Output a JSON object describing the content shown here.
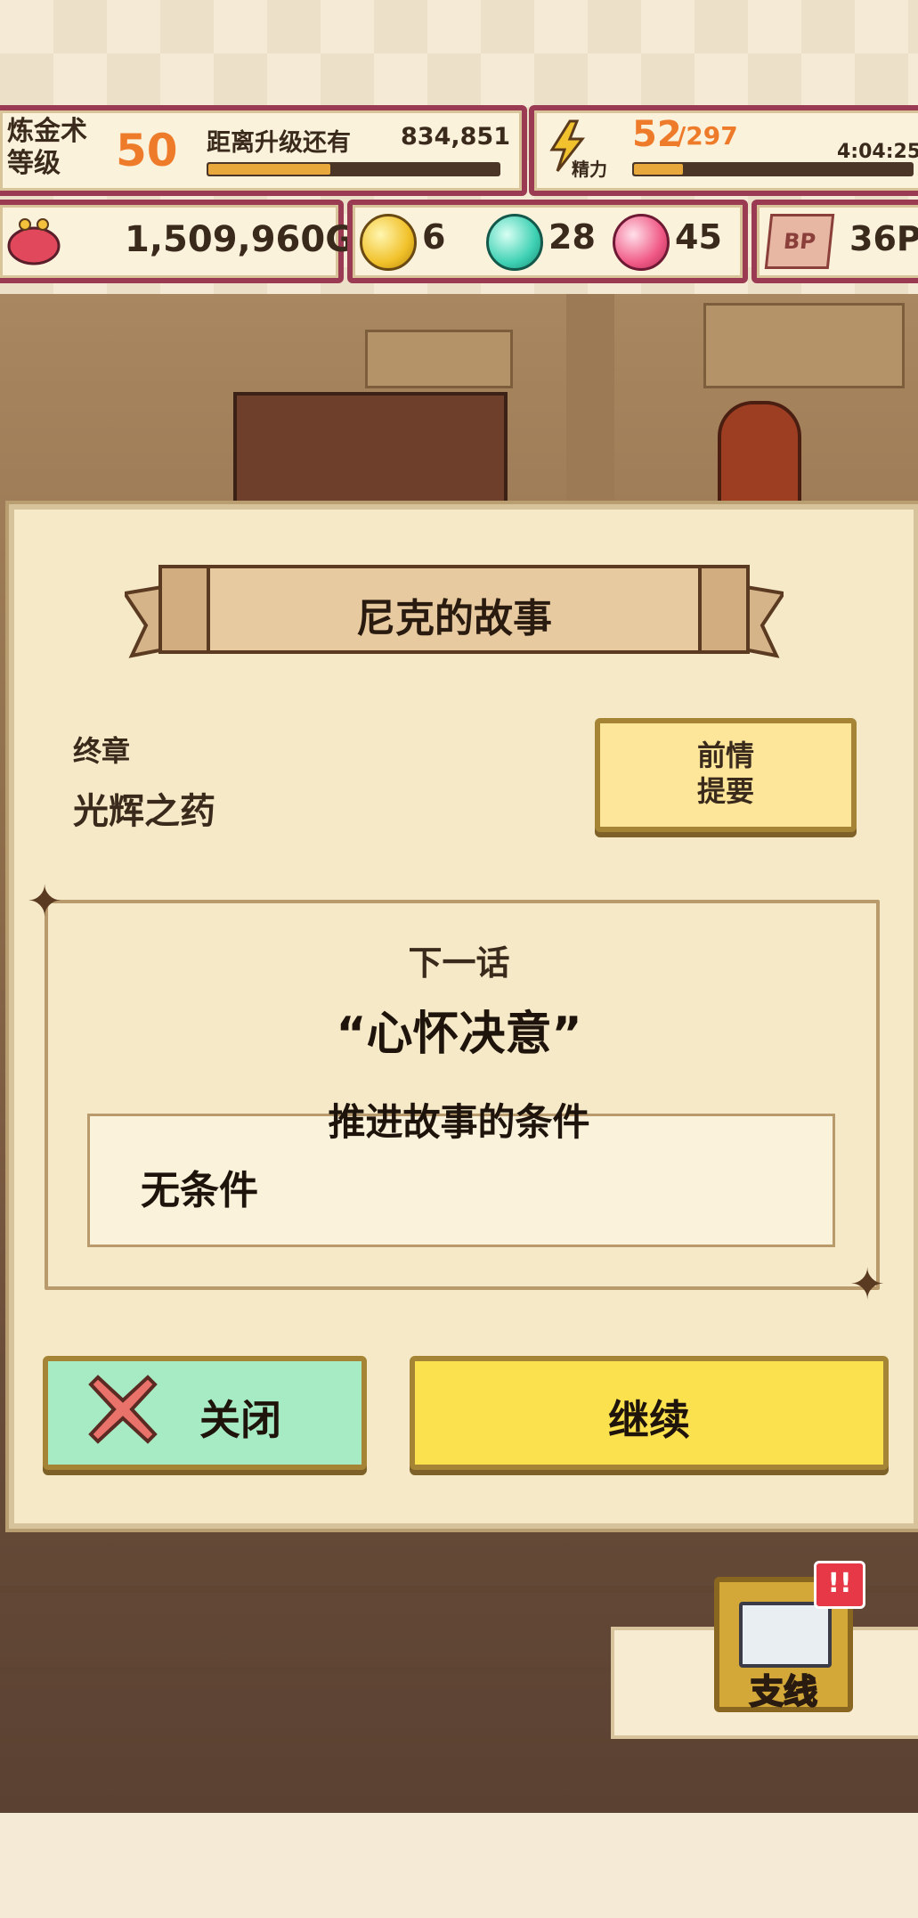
{
  "hud": {
    "level_label": "炼金术\n等级",
    "level_value": "50",
    "next_level_label": "距离升级还有",
    "next_level_value": "834,851",
    "xp_progress": 0.42,
    "stamina_icon_label": "精力",
    "stamina_current": "52",
    "stamina_max": "/297",
    "stamina_progress": 0.175,
    "stamina_timer": "4:04:25",
    "gold": "1,509,960G",
    "gem_yellow": "6",
    "gem_teal": "28",
    "gem_pink": "45",
    "bp_icon_label": "BP",
    "bp_value": "36P"
  },
  "dialog": {
    "title": "尼克的故事",
    "chapter_label": "终章",
    "chapter_name": "光辉之药",
    "recap_button": "前情\n提要",
    "next_label": "下一话",
    "next_title": "“心怀决意”",
    "condition_header": "推进故事的条件",
    "condition_value": "无条件",
    "close_button": "关闭",
    "continue_button": "继续"
  },
  "side": {
    "button_label": "支线",
    "badge": "!!"
  },
  "colors": {
    "accent_orange": "#ee7b2a",
    "hud_border": "#9b3b53",
    "continue_yellow": "#fce14f",
    "close_green": "#a7ebc4"
  }
}
